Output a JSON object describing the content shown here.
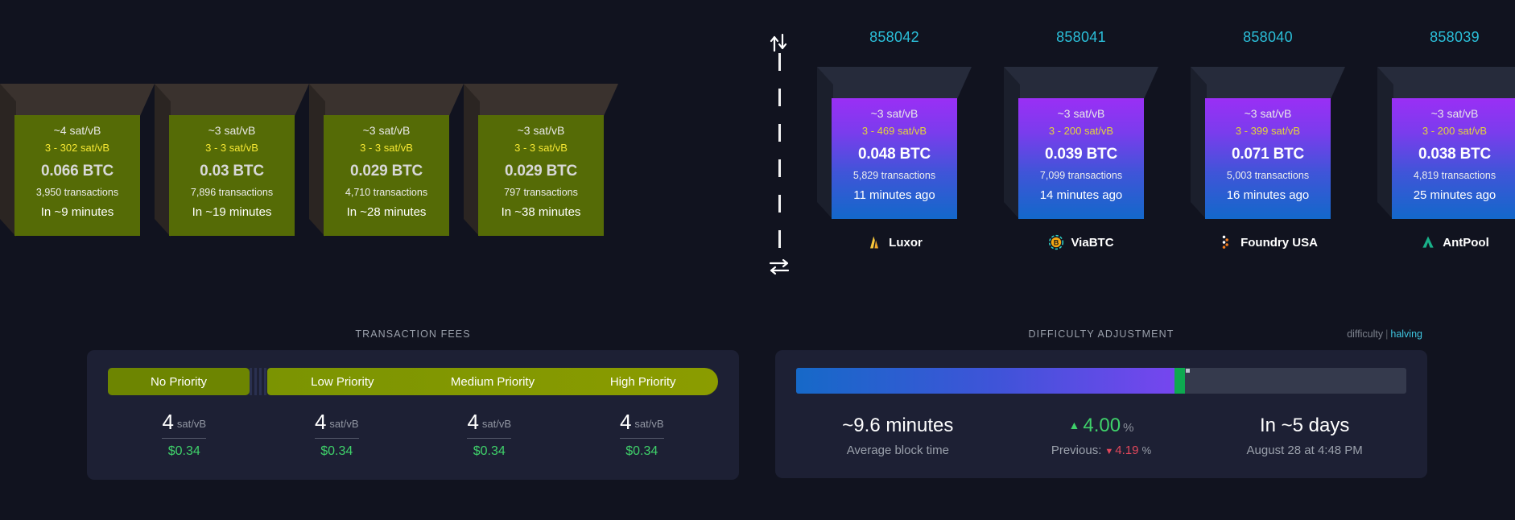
{
  "mempool": {
    "blocks": [
      {
        "median_fee": "~3 sat/vB",
        "fee_range": "3 - 3 sat/vB",
        "total_fees": "0.029 BTC",
        "tx_count": "797 transactions",
        "eta": "In ~38 minutes"
      },
      {
        "median_fee": "~3 sat/vB",
        "fee_range": "3 - 3 sat/vB",
        "total_fees": "0.029 BTC",
        "tx_count": "4,710 transactions",
        "eta": "In ~28 minutes"
      },
      {
        "median_fee": "~3 sat/vB",
        "fee_range": "3 - 3 sat/vB",
        "total_fees": "0.03 BTC",
        "tx_count": "7,896 transactions",
        "eta": "In ~19 minutes"
      },
      {
        "median_fee": "~4 sat/vB",
        "fee_range": "3 - 302 sat/vB",
        "total_fees": "0.066 BTC",
        "tx_count": "3,950 transactions",
        "eta": "In ~9 minutes"
      }
    ]
  },
  "divider": {
    "top_icon": "arrows-up-down-icon",
    "bottom_icon": "arrows-left-right-icon"
  },
  "blockchain": {
    "blocks": [
      {
        "height": "858042",
        "median_fee": "~3 sat/vB",
        "fee_range": "3 - 469 sat/vB",
        "total_fees": "0.048 BTC",
        "tx_count": "5,829 transactions",
        "age": "11 minutes ago",
        "pool": "Luxor",
        "pool_icon": "luxor-logo-icon"
      },
      {
        "height": "858041",
        "median_fee": "~3 sat/vB",
        "fee_range": "3 - 200 sat/vB",
        "total_fees": "0.039 BTC",
        "tx_count": "7,099 transactions",
        "age": "14 minutes ago",
        "pool": "ViaBTC",
        "pool_icon": "viabtc-logo-icon"
      },
      {
        "height": "858040",
        "median_fee": "~3 sat/vB",
        "fee_range": "3 - 399 sat/vB",
        "total_fees": "0.071 BTC",
        "tx_count": "5,003 transactions",
        "age": "16 minutes ago",
        "pool": "Foundry USA",
        "pool_icon": "foundry-usa-logo-icon"
      },
      {
        "height": "858039",
        "median_fee": "~3 sat/vB",
        "fee_range": "3 - 200 sat/vB",
        "total_fees": "0.038 BTC",
        "tx_count": "4,819 transactions",
        "age": "25 minutes ago",
        "pool": "AntPool",
        "pool_icon": "antpool-logo-icon"
      }
    ]
  },
  "transaction_fees": {
    "title": "TRANSACTION FEES",
    "segments": [
      {
        "label": "No Priority"
      },
      {
        "label": "Low Priority"
      },
      {
        "label": "Medium Priority"
      },
      {
        "label": "High Priority"
      }
    ],
    "rates": [
      {
        "value": "4",
        "unit": "sat/vB",
        "fiat": "$0.34"
      },
      {
        "value": "4",
        "unit": "sat/vB",
        "fiat": "$0.34"
      },
      {
        "value": "4",
        "unit": "sat/vB",
        "fiat": "$0.34"
      },
      {
        "value": "4",
        "unit": "sat/vB",
        "fiat": "$0.34"
      }
    ]
  },
  "difficulty_adjustment": {
    "title": "DIFFICULTY ADJUSTMENT",
    "link_difficulty": "difficulty",
    "link_separator": "|",
    "link_halving": "halving",
    "progress_percent": 62,
    "avg_block_time": "~9.6 minutes",
    "avg_block_time_label": "Average block time",
    "change_value": "4.00",
    "change_pct_sign": "%",
    "change_direction": "up",
    "previous_label": "Previous:",
    "previous_value": "4.19",
    "previous_pct_sign": "%",
    "previous_direction": "down",
    "remaining": "In ~5 days",
    "estimated_date": "August 28 at 4:48 PM"
  },
  "colors": {
    "background": "#11131f",
    "mempool_block": "#556b06",
    "block_height_link": "#2bbfd9",
    "fiat_green": "#3fd16a",
    "negative_red": "#e2475b",
    "fee_range_yellow": "#f5e732"
  }
}
